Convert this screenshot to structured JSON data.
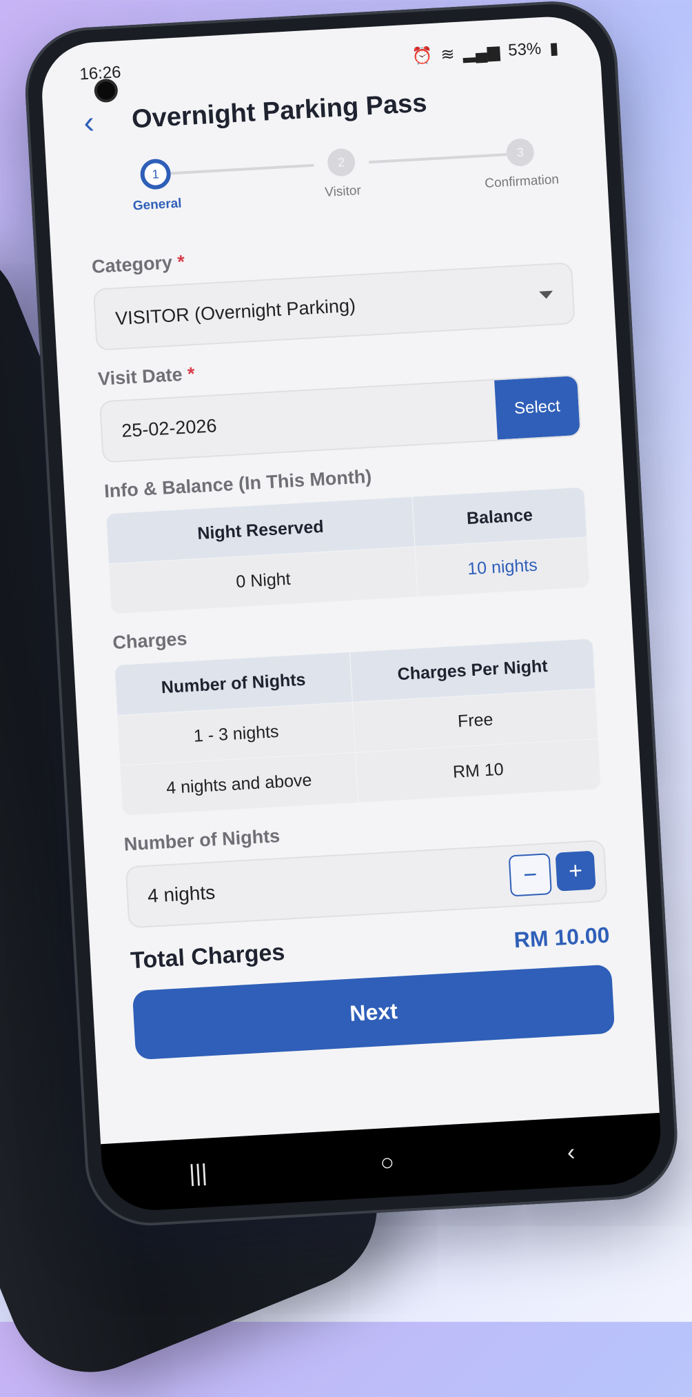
{
  "status": {
    "time": "16:26",
    "battery": "53%"
  },
  "header": {
    "title": "Overnight Parking Pass"
  },
  "stepper": [
    {
      "num": "1",
      "label": "General"
    },
    {
      "num": "2",
      "label": "Visitor"
    },
    {
      "num": "3",
      "label": "Confirmation"
    }
  ],
  "category": {
    "label": "Category",
    "required": "*",
    "value": "VISITOR (Overnight Parking)"
  },
  "visit_date": {
    "label": "Visit Date",
    "required": "*",
    "value": "25-02-2026",
    "button": "Select"
  },
  "info": {
    "label": "Info & Balance (In This Month)",
    "headers": [
      "Night Reserved",
      "Balance"
    ],
    "values": [
      "0 Night",
      "10 nights"
    ]
  },
  "charges": {
    "label": "Charges",
    "headers": [
      "Number of Nights",
      "Charges Per Night"
    ],
    "rows": [
      [
        "1 - 3  nights",
        "Free"
      ],
      [
        "4 nights and above",
        "RM 10"
      ]
    ]
  },
  "nights": {
    "label": "Number of Nights",
    "value": "4 nights",
    "minus": "−",
    "plus": "+"
  },
  "total": {
    "label": "Total Charges",
    "amount": "RM 10.00"
  },
  "next_button": "Next",
  "nav": {
    "recents": "|||",
    "home": "○",
    "back": "‹"
  },
  "colors": {
    "accent": "#2f5fb8",
    "required": "#d93b4a"
  }
}
